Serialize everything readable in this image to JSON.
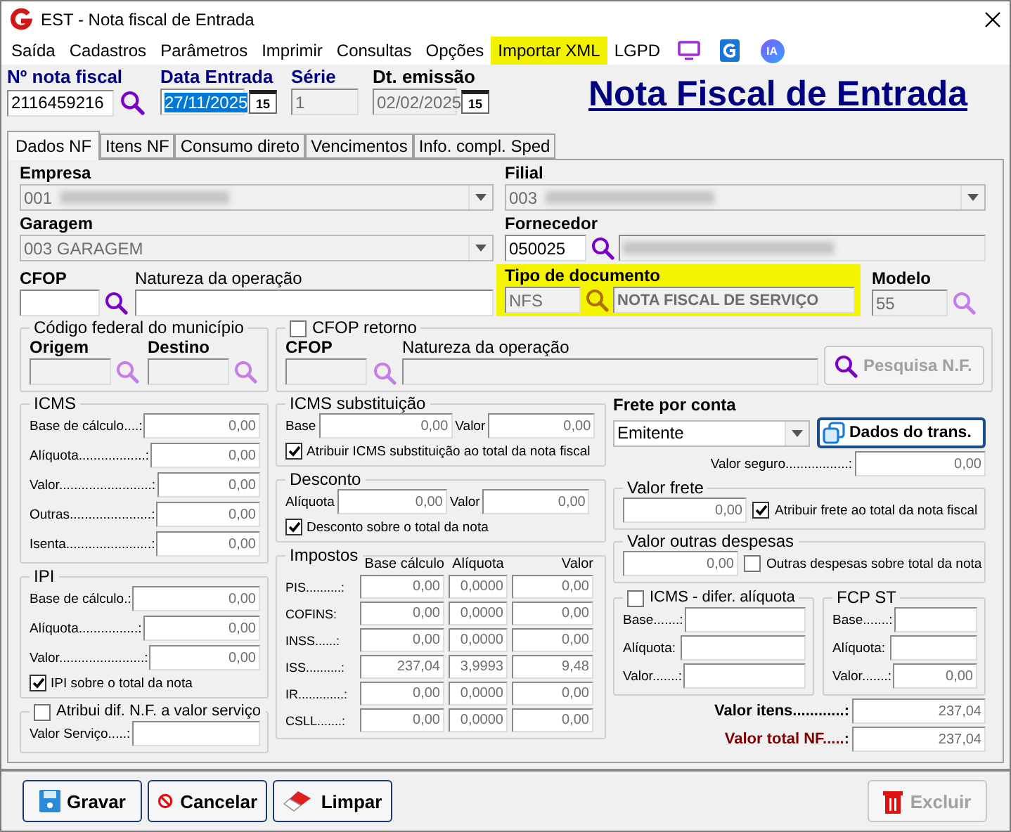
{
  "window": {
    "title": "EST - Nota fiscal de Entrada"
  },
  "menu": [
    {
      "label": "Saída",
      "highlighted": false
    },
    {
      "label": "Cadastros",
      "highlighted": false
    },
    {
      "label": "Parâmetros",
      "highlighted": false
    },
    {
      "label": "Imprimir",
      "highlighted": false
    },
    {
      "label": "Consultas",
      "highlighted": false
    },
    {
      "label": "Opções",
      "highlighted": false
    },
    {
      "label": "Importar XML",
      "highlighted": true
    },
    {
      "label": "LGPD",
      "highlighted": false
    }
  ],
  "menu_icons": [
    {
      "kind": "monitor"
    },
    {
      "kind": "book"
    },
    {
      "kind": "badge",
      "label": "IA"
    }
  ],
  "header": [
    {
      "label": "Nº nota fiscal",
      "emphasized": true,
      "kind": "search",
      "field": {
        "value": "2116459216",
        "disabled": false
      }
    },
    {
      "label": "Data Entrada",
      "emphasized": true,
      "kind": "date",
      "calendar": "15",
      "field": {
        "value": "27/11/2025",
        "disabled": false,
        "selected": true
      }
    },
    {
      "label": "Série",
      "emphasized": true,
      "kind": "plain",
      "field": {
        "value": "1",
        "disabled": true
      }
    },
    {
      "label": "Dt. emissão",
      "emphasized": false,
      "kind": "date",
      "calendar": "15",
      "field": {
        "value": "02/02/2025",
        "disabled": true
      }
    }
  ],
  "page_title": "Nota Fiscal de Entrada",
  "tabs": [
    {
      "label": "Dados NF",
      "selected": true
    },
    {
      "label": "Itens NF",
      "selected": false
    },
    {
      "label": "Consumo direto",
      "selected": false
    },
    {
      "label": "Vencimentos",
      "selected": false
    },
    {
      "label": "Info. compl. Sped",
      "selected": false
    }
  ],
  "empresa": {
    "label": "Empresa",
    "field": {
      "value": "001",
      "disabled": true,
      "redacted": true
    }
  },
  "filial": {
    "label": "Filial",
    "field": {
      "value": "003",
      "disabled": true,
      "redacted": true
    }
  },
  "garagem": {
    "label": "Garagem",
    "field": {
      "value": "003 GARAGEM",
      "disabled": true
    }
  },
  "fornecedor": {
    "label": "Fornecedor",
    "code": {
      "value": "050025",
      "disabled": false
    },
    "name": {
      "disabled": true,
      "redacted": true
    }
  },
  "cfop": {
    "label": "CFOP",
    "code": {
      "disabled": false
    },
    "nature_label": "Natureza da operação",
    "nature": {
      "disabled": false
    }
  },
  "tipo_documento": {
    "label": "Tipo de documento",
    "highlighted": true,
    "code": {
      "value": "NFS",
      "disabled": true
    },
    "name": {
      "value": "NOTA FISCAL DE SERVIÇO",
      "disabled": true
    }
  },
  "modelo": {
    "label": "Modelo",
    "field": {
      "value": "55",
      "disabled": true
    }
  },
  "codigo_federal": {
    "title": "Código federal do município",
    "items": [
      {
        "label": "Origem",
        "field": {
          "disabled": true
        }
      },
      {
        "label": "Destino",
        "field": {
          "disabled": true
        }
      }
    ]
  },
  "cfop_retorno": {
    "label": "CFOP retorno",
    "checked": false,
    "cfop_label": "CFOP",
    "cfop": {
      "disabled": true
    },
    "nature_label": "Natureza da operação",
    "nature": {
      "disabled": true
    },
    "button": {
      "label": "Pesquisa N.F.",
      "disabled": true
    }
  },
  "icms": {
    "title": "ICMS",
    "rows": [
      {
        "label": "Base de cálculo....:",
        "value": "0,00"
      },
      {
        "label": "Alíquota..................:",
        "value": "0,00"
      },
      {
        "label": "Valor.........................:",
        "value": "0,00"
      },
      {
        "label": "Outras......................:",
        "value": "0,00"
      },
      {
        "label": "Isenta.......................:",
        "value": "0,00"
      }
    ]
  },
  "ipi": {
    "title": "IPI",
    "rows": [
      {
        "label": "Base de cálculo.:",
        "value": "0,00"
      },
      {
        "label": "Alíquota................:",
        "value": "0,00"
      },
      {
        "label": "Valor.......................:",
        "value": "0,00"
      }
    ],
    "checkbox": {
      "label": "IPI sobre o total da nota",
      "checked": true
    }
  },
  "dif_servico": {
    "label": "Atribui dif. N.F. a valor serviço",
    "checked": false,
    "field_label": "Valor Serviço.....:"
  },
  "icms_st": {
    "title": "ICMS substituição",
    "fields": [
      {
        "label": "Base",
        "value": "0,00"
      },
      {
        "label": "Valor",
        "value": "0,00"
      }
    ],
    "checkbox": {
      "label": "Atribuir ICMS substituição ao total da nota fiscal",
      "checked": true
    }
  },
  "desconto": {
    "title": "Desconto",
    "fields": [
      {
        "label": "Alíquota",
        "value": "0,00"
      },
      {
        "label": "Valor",
        "value": "0,00"
      }
    ],
    "checkbox": {
      "label": "Desconto sobre o total da nota",
      "checked": true
    }
  },
  "impostos": {
    "title": "Impostos",
    "columns": [
      "Base cálculo",
      "Alíquota",
      "Valor"
    ],
    "rows": [
      {
        "label": "PIS..........:",
        "cells": [
          "0,00",
          "0,0000",
          "0,00"
        ]
      },
      {
        "label": "COFINS:",
        "cells": [
          "0,00",
          "0,0000",
          "0,00"
        ]
      },
      {
        "label": "INSS......:",
        "cells": [
          "0,00",
          "0,0000",
          "0,00"
        ]
      },
      {
        "label": "ISS..........:",
        "cells": [
          "237,04",
          "3,9993",
          "9,48"
        ]
      },
      {
        "label": "IR.............:",
        "cells": [
          "0,00",
          "0,0000",
          "0,00"
        ]
      },
      {
        "label": "CSLL.......:",
        "cells": [
          "0,00",
          "0,0000",
          "0,00"
        ]
      }
    ]
  },
  "frete": {
    "label": "Frete por conta",
    "value": "Emitente",
    "button": "Dados do trans.",
    "seguro_label": "Valor seguro.................:",
    "seguro": "0,00"
  },
  "valor_frete": {
    "title": "Valor frete",
    "value": "0,00",
    "checkbox": {
      "label": "Atribuir frete ao total da nota fiscal",
      "checked": true
    }
  },
  "outras_despesas": {
    "title": "Valor outras despesas",
    "value": "0,00",
    "checkbox": {
      "label": "Outras despesas sobre total da nota",
      "checked": false
    }
  },
  "icms_difer": {
    "title": "ICMS - difer. alíquota",
    "checked": false,
    "rows": [
      {
        "label": "Base.......:"
      },
      {
        "label": "Alíquota:"
      },
      {
        "label": "Valor.......:"
      }
    ]
  },
  "fcp_st": {
    "title": "FCP ST",
    "rows": [
      {
        "label": "Base.......:"
      },
      {
        "label": "Alíquota:"
      },
      {
        "label": "Valor.......:",
        "value": "0,00"
      }
    ]
  },
  "totals": [
    {
      "label": "Valor itens............:",
      "value": "237,04",
      "kind": "normal"
    },
    {
      "label": "Valor total NF.....:",
      "value": "237,04",
      "kind": "emphasis"
    }
  ],
  "actions": [
    {
      "label": "Gravar",
      "kind": "save",
      "disabled": false
    },
    {
      "label": "Cancelar",
      "kind": "cancel",
      "disabled": false
    },
    {
      "label": "Limpar",
      "kind": "clear",
      "disabled": false
    },
    {
      "label": "Excluir",
      "kind": "delete",
      "disabled": true
    }
  ]
}
